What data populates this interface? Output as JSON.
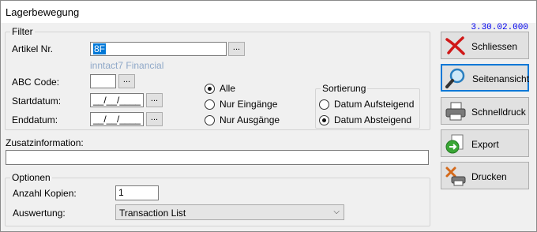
{
  "window": {
    "title": "Lagerbewegung",
    "version": "3.30.02.000"
  },
  "filter": {
    "legend": "Filter",
    "artikel_label": "Artikel Nr.",
    "artikel_value": "8F",
    "artikel_hint": "inntact7 Financial",
    "abc_label": "ABC Code:",
    "abc_value": "",
    "start_label": "Startdatum:",
    "start_value": "__/__/____",
    "end_label": "Enddatum:",
    "end_value": "__/__/____",
    "browse_label": "...",
    "direction": [
      {
        "label": "Alle",
        "checked": true
      },
      {
        "label": "Nur Eingänge",
        "checked": false
      },
      {
        "label": "Nur Ausgänge",
        "checked": false
      }
    ],
    "sort_legend": "Sortierung",
    "sort": [
      {
        "label": "Datum Aufsteigend",
        "checked": false
      },
      {
        "label": "Datum Absteigend",
        "checked": true
      }
    ]
  },
  "zusatz": {
    "label": "Zusatzinformation:",
    "value": ""
  },
  "optionen": {
    "legend": "Optionen",
    "kopien_label": "Anzahl Kopien:",
    "kopien_value": "1",
    "auswertung_label": "Auswertung:",
    "auswertung_value": "Transaction List"
  },
  "buttons": {
    "schliessen": "Schliessen",
    "seitenansicht": "Seitenansicht",
    "schnelldruck": "Schnelldruck",
    "export": "Export",
    "drucken": "Drucken"
  },
  "icons": {
    "schliessen": "close-x-icon",
    "seitenansicht": "magnifier-icon",
    "schnelldruck": "printer-icon",
    "export": "export-arrow-icon",
    "drucken": "print-tools-icon"
  }
}
